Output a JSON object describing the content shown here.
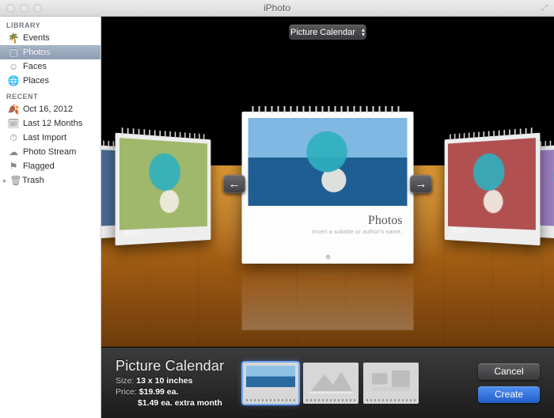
{
  "app": {
    "title": "iPhoto"
  },
  "sidebar": {
    "sections": [
      {
        "header": "LIBRARY",
        "items": [
          {
            "label": "Events",
            "icon": "🌴",
            "selected": false
          },
          {
            "label": "Photos",
            "icon": "▢",
            "selected": true
          },
          {
            "label": "Faces",
            "icon": "☺",
            "selected": false
          },
          {
            "label": "Places",
            "icon": "🌐",
            "selected": false
          }
        ]
      },
      {
        "header": "RECENT",
        "items": [
          {
            "label": "Oct 16, 2012",
            "icon": "🍂",
            "selected": false
          },
          {
            "label": "Last 12 Months",
            "icon": "🗓",
            "selected": false
          },
          {
            "label": "Last Import",
            "icon": "⏱",
            "selected": false
          },
          {
            "label": "Photo Stream",
            "icon": "☁︎",
            "selected": false
          },
          {
            "label": "Flagged",
            "icon": "⚑",
            "selected": false
          }
        ]
      }
    ],
    "trash": {
      "label": "Trash",
      "icon": "🗑"
    }
  },
  "stage": {
    "selector": {
      "label": "Picture Calendar"
    },
    "nav": {
      "prev": "←",
      "next": "→"
    },
    "center": {
      "title": "Photos",
      "subtitle": "Insert a subtitle or author's name."
    },
    "side_label": "Photos"
  },
  "bottom": {
    "product": {
      "name": "Picture Calendar",
      "size_label": "Size:",
      "size_value": "13 x 10 inches",
      "price_label": "Price:",
      "price_value": "$19.99 ea.",
      "extra": "$1.49 ea. extra month"
    },
    "buttons": {
      "cancel": "Cancel",
      "create": "Create"
    }
  }
}
